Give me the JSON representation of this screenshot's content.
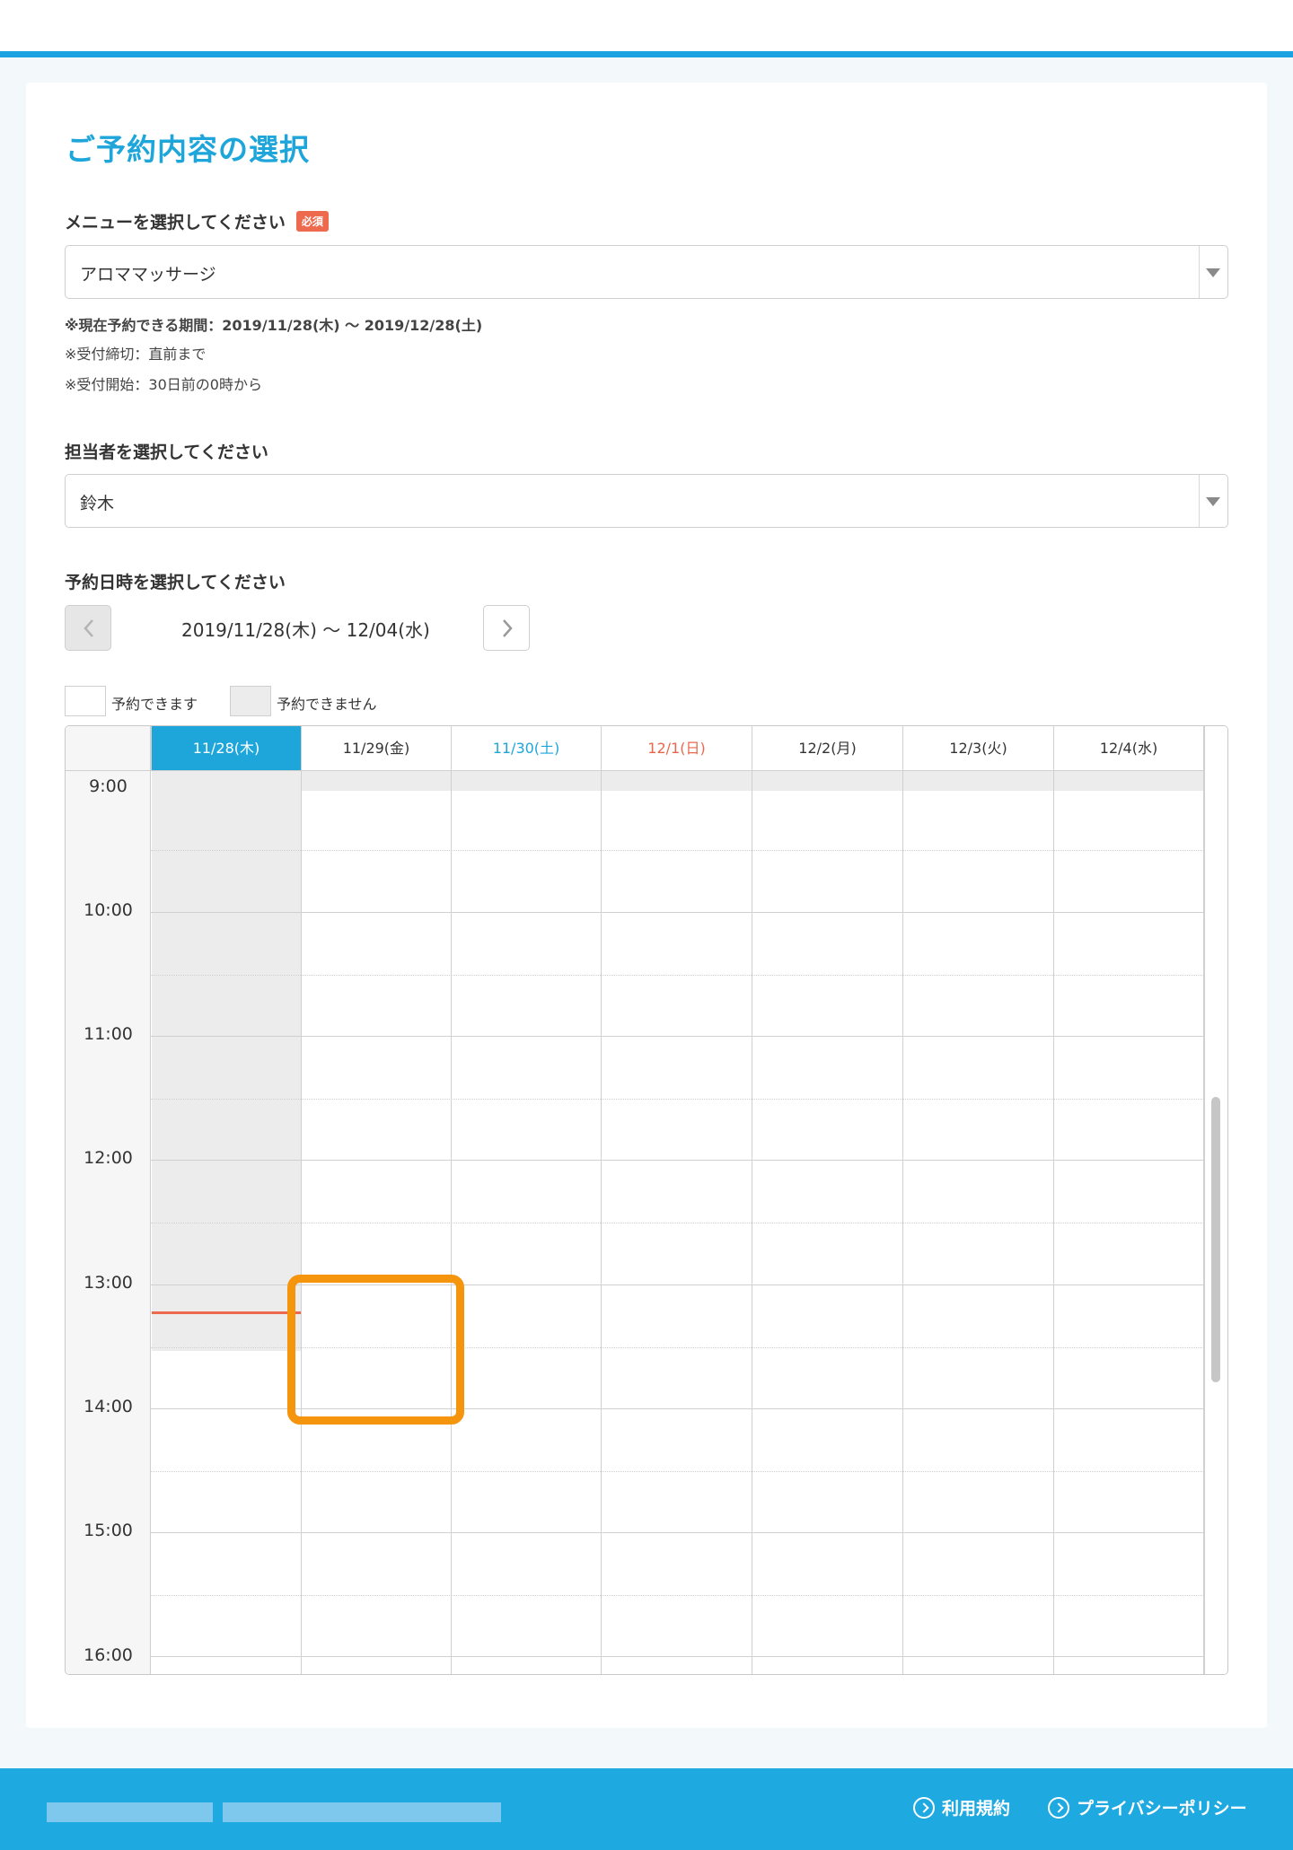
{
  "page": {
    "title": "ご予約内容の選択"
  },
  "menu": {
    "label": "メニューを選択してください",
    "required_badge": "必須",
    "selected": "アロママッサージ",
    "notes": [
      "※現在予約できる期間：2019/11/28(木) ～ 2019/12/28(土)",
      "※受付締切：直前まで",
      "※受付開始：30日前の0時から"
    ]
  },
  "staff": {
    "label": "担当者を選択してください",
    "selected": "鈴木"
  },
  "datetime": {
    "label": "予約日時を選択してください",
    "range": "2019/11/28(木) ～ 12/04(水)",
    "legend": {
      "available": "予約できます",
      "unavailable": "予約できません"
    }
  },
  "calendar": {
    "days": [
      "11/28(木)",
      "11/29(金)",
      "11/30(土)",
      "12/1(日)",
      "12/2(月)",
      "12/3(火)",
      "12/4(水)"
    ],
    "times": [
      "9:00",
      "10:00",
      "11:00",
      "12:00",
      "13:00",
      "14:00",
      "15:00",
      "16:00"
    ],
    "today_index": 0,
    "colors": {
      "today_header": "#1ea6db",
      "saturday": "#1ea6db",
      "sunday": "#e9674d",
      "unavailable": "#ececec",
      "current_time_line": "#ee6a4f",
      "highlight": "#f5950d"
    }
  },
  "footer": {
    "links": [
      "利用規約",
      "プライバシーポリシー"
    ]
  }
}
